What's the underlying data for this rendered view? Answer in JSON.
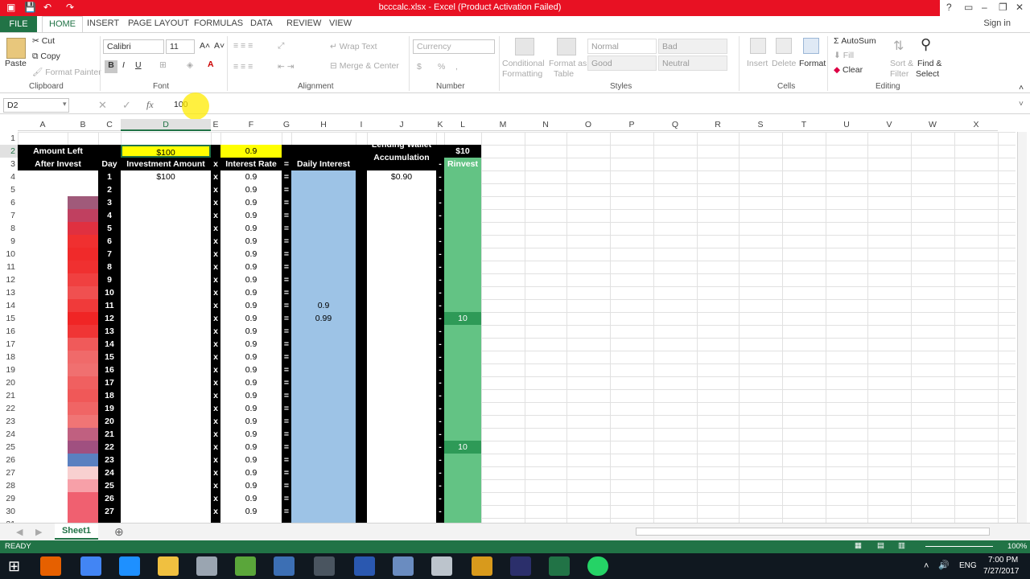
{
  "window": {
    "title": "bcccalc.xlsx -  Excel (Product Activation Failed)"
  },
  "ribbon_tabs": {
    "file": "FILE",
    "home": "HOME",
    "insert": "INSERT",
    "page_layout": "PAGE LAYOUT",
    "formulas": "FORMULAS",
    "data": "DATA",
    "review": "REVIEW",
    "view": "VIEW",
    "sign_in": "Sign in"
  },
  "ribbon": {
    "clipboard": {
      "paste": "Paste",
      "cut": "Cut",
      "copy": "Copy",
      "format_painter": "Format Painter",
      "group": "Clipboard"
    },
    "font": {
      "name": "Calibri",
      "size": "11",
      "bold": "B",
      "italic": "I",
      "underline": "U",
      "group": "Font"
    },
    "alignment": {
      "wrap": "Wrap Text",
      "merge": "Merge & Center",
      "group": "Alignment"
    },
    "number": {
      "format": "Currency",
      "dollar": "$",
      "percent": "%",
      "comma": ",",
      "group": "Number"
    },
    "styles": {
      "conditional": "Conditional",
      "conditional2": "Formatting",
      "format_as": "Format as",
      "format_as2": "Table",
      "normal": "Normal",
      "bad": "Bad",
      "good": "Good",
      "neutral": "Neutral",
      "group": "Styles"
    },
    "cells": {
      "insert": "Insert",
      "delete": "Delete",
      "format": "Format",
      "group": "Cells"
    },
    "editing": {
      "autosum": "AutoSum",
      "fill": "Fill",
      "clear": "Clear",
      "sort": "Sort &",
      "sort2": "Filter",
      "find": "Find &",
      "find2": "Select",
      "group": "Editing"
    }
  },
  "formula_bar": {
    "name_box": "D2",
    "fx": "fx",
    "value": "100"
  },
  "columns": [
    "A",
    "B",
    "C",
    "D",
    "E",
    "F",
    "G",
    "H",
    "I",
    "J",
    "K",
    "L",
    "M",
    "N",
    "O",
    "P",
    "Q",
    "R",
    "S",
    "T",
    "U",
    "V",
    "W",
    "X"
  ],
  "sheet": {
    "amount_left": "Amount Left",
    "after_invest": "After Invest",
    "d2": "$100",
    "f2": "0.9",
    "l2": "$10",
    "lending_wallet": "Lending Wallet",
    "accumulation": "Accumulation",
    "day": "Day",
    "investment_amount": "Investment Amount",
    "x": "x",
    "interest_rate": "Interest Rate",
    "eq": "=",
    "daily_interest": "Daily Interest",
    "dash": "-",
    "rinvest": "Rinvest",
    "d4": "$100",
    "j4": "$0.90",
    "days": [
      "1",
      "2",
      "3",
      "4",
      "5",
      "6",
      "7",
      "8",
      "9",
      "10",
      "11",
      "12",
      "13",
      "14",
      "15",
      "16",
      "17",
      "18",
      "19",
      "20",
      "21",
      "22",
      "23",
      "24",
      "25",
      "26",
      "27"
    ],
    "rate": "0.9",
    "h14": "0.9",
    "h15": "0.99",
    "l15": "10",
    "l25": "10"
  },
  "sheet_tab": "Sheet1",
  "status": {
    "ready": "READY",
    "zoom": "100%"
  },
  "taskbar": {
    "lang": "ENG",
    "time": "7:00 PM",
    "date": "7/27/2017"
  }
}
